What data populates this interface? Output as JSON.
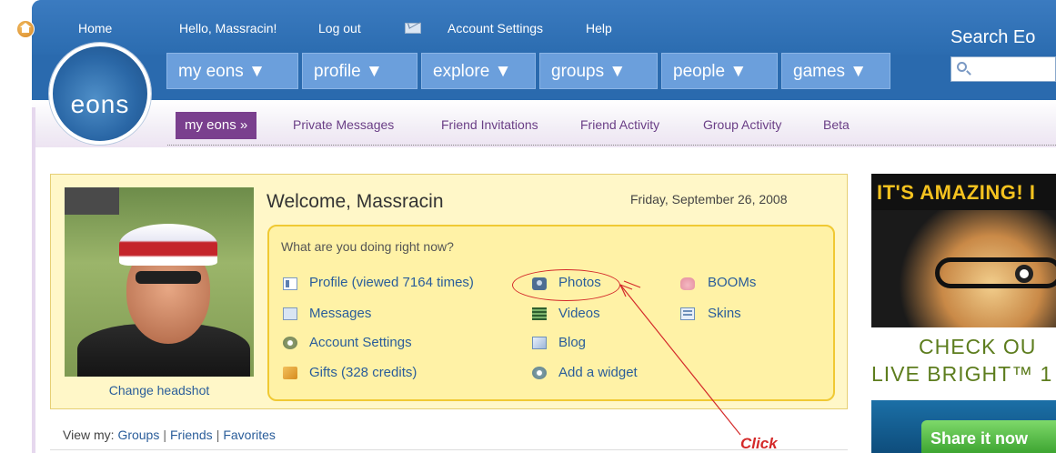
{
  "header": {
    "home": "Home",
    "greeting": "Hello, Massracin!",
    "logout": "Log out",
    "account_settings": "Account Settings",
    "help": "Help",
    "search_label": "Search Eo",
    "logo": "eons"
  },
  "nav": {
    "tabs": [
      "my eons ▼",
      "profile ▼",
      "explore ▼",
      "groups ▼",
      "people ▼",
      "games ▼"
    ]
  },
  "subnav": {
    "current": "my eons »",
    "links": [
      "Private Messages",
      "Friend Invitations",
      "Friend Activity",
      "Group Activity",
      "Beta"
    ]
  },
  "profile": {
    "change_headshot": "Change headshot",
    "welcome": "Welcome, Massracin",
    "date": "Friday, September 26, 2008",
    "question": "What are you doing right now?"
  },
  "links": {
    "profile": "Profile (viewed 7164 times)",
    "messages": "Messages",
    "account_settings": "Account Settings",
    "gifts": "Gifts (328 credits)",
    "photos": "Photos",
    "videos": "Videos",
    "blog": "Blog",
    "widget": "Add a widget",
    "booms": "BOOMs",
    "skins": "Skins"
  },
  "annotation": {
    "click": "Click"
  },
  "viewmy": {
    "label": "View my:",
    "links": [
      "Groups",
      "Friends",
      "Favorites"
    ]
  },
  "ad": {
    "headline": "IT'S AMAZING! I",
    "line1": "CHECK OU",
    "line2": "LIVE BRIGHT™ 1",
    "button": "Share it now"
  },
  "colors": {
    "header_blue": "#2a6aae",
    "tab_blue": "#6b9fdc",
    "subnav_purple": "#7a3f8e",
    "panel_yellow": "#fff7c8",
    "link_blue": "#2a5d9a",
    "annotation_red": "#d42a2a"
  }
}
